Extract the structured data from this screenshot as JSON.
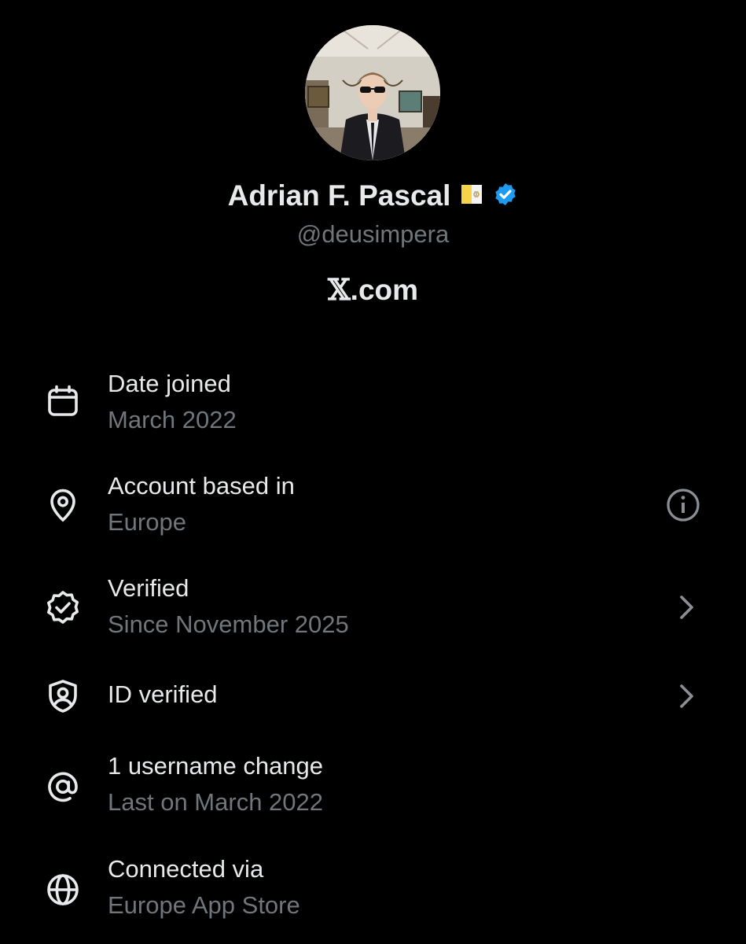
{
  "profile": {
    "display_name": "Adrian F. Pascal",
    "flag_emoji": "vatican-flag",
    "verified_badge_color": "#1d9bf0",
    "handle": "@deusimpera",
    "site_x": "𝕏",
    "site_rest": ".com"
  },
  "colors": {
    "background": "#000000",
    "primary_text": "#e7e9ea",
    "secondary_text": "#71767b"
  },
  "rows": [
    {
      "icon": "calendar-icon",
      "title": "Date joined",
      "subtitle": "March 2022",
      "trailing": ""
    },
    {
      "icon": "location-pin-icon",
      "title": "Account based in",
      "subtitle": "Europe",
      "trailing": "info-icon"
    },
    {
      "icon": "verified-badge-icon",
      "title": "Verified",
      "subtitle": "Since November 2025",
      "trailing": "chevron-right-icon"
    },
    {
      "icon": "shield-user-icon",
      "title": "ID verified",
      "subtitle": "",
      "trailing": "chevron-right-icon"
    },
    {
      "icon": "at-sign-icon",
      "title": "1 username change",
      "subtitle": "Last on March 2022",
      "trailing": ""
    },
    {
      "icon": "globe-icon",
      "title": "Connected via",
      "subtitle": "Europe App Store",
      "trailing": ""
    }
  ]
}
